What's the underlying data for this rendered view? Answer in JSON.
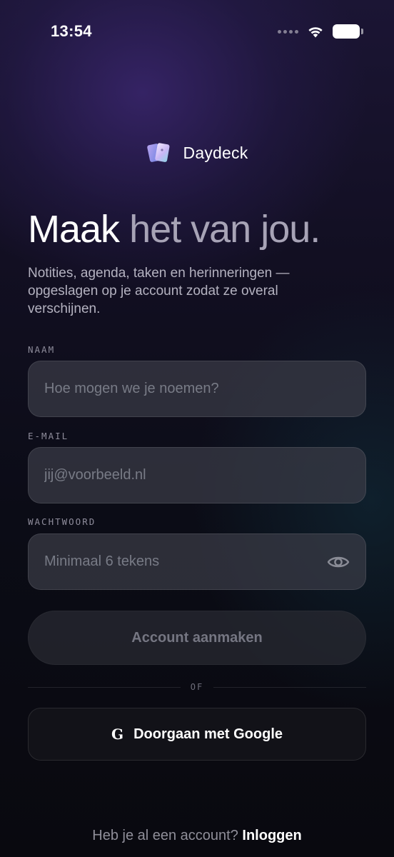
{
  "status_bar": {
    "time": "13:54",
    "icons": [
      "cellular-icon",
      "wifi-icon",
      "battery-icon"
    ]
  },
  "brand": {
    "name": "Daydeck",
    "logo_icon": "cards-logo-icon"
  },
  "headline": {
    "part1": "Maak",
    "part2": "het van jou."
  },
  "subtitle": "Notities, agenda, taken en herinneringen — opgeslagen op je account zodat ze overal verschijnen.",
  "form": {
    "name": {
      "label": "NAAM",
      "placeholder": "Hoe mogen we je noemen?",
      "value": ""
    },
    "email": {
      "label": "E-MAIL",
      "placeholder": "jij@voorbeeld.nl",
      "value": ""
    },
    "password": {
      "label": "WACHTWOORD",
      "placeholder": "Minimaal 6 tekens",
      "value": "",
      "toggle_icon": "eye-icon"
    },
    "submit_label": "Account aanmaken"
  },
  "divider_text": "OF",
  "google": {
    "glyph": "G",
    "label": "Doorgaan met Google"
  },
  "footer": {
    "question": "Heb je al een account?",
    "link": "Inloggen"
  },
  "colors": {
    "background_top": "#1b1534",
    "background_bottom": "#09090f",
    "headline_muted": "#a7a3b6",
    "field_bg": "#3a3c46",
    "button_disabled_text": "#757682"
  }
}
